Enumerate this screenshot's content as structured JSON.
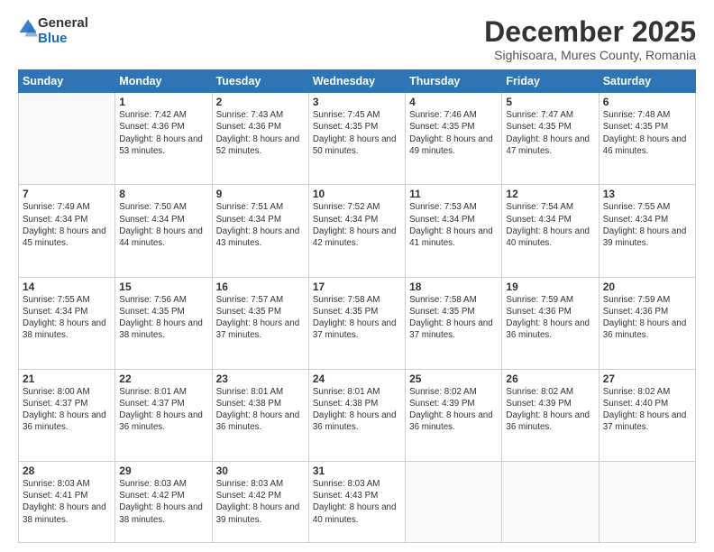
{
  "header": {
    "logo_general": "General",
    "logo_blue": "Blue",
    "month_title": "December 2025",
    "location": "Sighisoara, Mures County, Romania"
  },
  "days_of_week": [
    "Sunday",
    "Monday",
    "Tuesday",
    "Wednesday",
    "Thursday",
    "Friday",
    "Saturday"
  ],
  "weeks": [
    [
      {
        "day": "",
        "sunrise": "",
        "sunset": "",
        "daylight": ""
      },
      {
        "day": "1",
        "sunrise": "Sunrise: 7:42 AM",
        "sunset": "Sunset: 4:36 PM",
        "daylight": "Daylight: 8 hours and 53 minutes."
      },
      {
        "day": "2",
        "sunrise": "Sunrise: 7:43 AM",
        "sunset": "Sunset: 4:36 PM",
        "daylight": "Daylight: 8 hours and 52 minutes."
      },
      {
        "day": "3",
        "sunrise": "Sunrise: 7:45 AM",
        "sunset": "Sunset: 4:35 PM",
        "daylight": "Daylight: 8 hours and 50 minutes."
      },
      {
        "day": "4",
        "sunrise": "Sunrise: 7:46 AM",
        "sunset": "Sunset: 4:35 PM",
        "daylight": "Daylight: 8 hours and 49 minutes."
      },
      {
        "day": "5",
        "sunrise": "Sunrise: 7:47 AM",
        "sunset": "Sunset: 4:35 PM",
        "daylight": "Daylight: 8 hours and 47 minutes."
      },
      {
        "day": "6",
        "sunrise": "Sunrise: 7:48 AM",
        "sunset": "Sunset: 4:35 PM",
        "daylight": "Daylight: 8 hours and 46 minutes."
      }
    ],
    [
      {
        "day": "7",
        "sunrise": "Sunrise: 7:49 AM",
        "sunset": "Sunset: 4:34 PM",
        "daylight": "Daylight: 8 hours and 45 minutes."
      },
      {
        "day": "8",
        "sunrise": "Sunrise: 7:50 AM",
        "sunset": "Sunset: 4:34 PM",
        "daylight": "Daylight: 8 hours and 44 minutes."
      },
      {
        "day": "9",
        "sunrise": "Sunrise: 7:51 AM",
        "sunset": "Sunset: 4:34 PM",
        "daylight": "Daylight: 8 hours and 43 minutes."
      },
      {
        "day": "10",
        "sunrise": "Sunrise: 7:52 AM",
        "sunset": "Sunset: 4:34 PM",
        "daylight": "Daylight: 8 hours and 42 minutes."
      },
      {
        "day": "11",
        "sunrise": "Sunrise: 7:53 AM",
        "sunset": "Sunset: 4:34 PM",
        "daylight": "Daylight: 8 hours and 41 minutes."
      },
      {
        "day": "12",
        "sunrise": "Sunrise: 7:54 AM",
        "sunset": "Sunset: 4:34 PM",
        "daylight": "Daylight: 8 hours and 40 minutes."
      },
      {
        "day": "13",
        "sunrise": "Sunrise: 7:55 AM",
        "sunset": "Sunset: 4:34 PM",
        "daylight": "Daylight: 8 hours and 39 minutes."
      }
    ],
    [
      {
        "day": "14",
        "sunrise": "Sunrise: 7:55 AM",
        "sunset": "Sunset: 4:34 PM",
        "daylight": "Daylight: 8 hours and 38 minutes."
      },
      {
        "day": "15",
        "sunrise": "Sunrise: 7:56 AM",
        "sunset": "Sunset: 4:35 PM",
        "daylight": "Daylight: 8 hours and 38 minutes."
      },
      {
        "day": "16",
        "sunrise": "Sunrise: 7:57 AM",
        "sunset": "Sunset: 4:35 PM",
        "daylight": "Daylight: 8 hours and 37 minutes."
      },
      {
        "day": "17",
        "sunrise": "Sunrise: 7:58 AM",
        "sunset": "Sunset: 4:35 PM",
        "daylight": "Daylight: 8 hours and 37 minutes."
      },
      {
        "day": "18",
        "sunrise": "Sunrise: 7:58 AM",
        "sunset": "Sunset: 4:35 PM",
        "daylight": "Daylight: 8 hours and 37 minutes."
      },
      {
        "day": "19",
        "sunrise": "Sunrise: 7:59 AM",
        "sunset": "Sunset: 4:36 PM",
        "daylight": "Daylight: 8 hours and 36 minutes."
      },
      {
        "day": "20",
        "sunrise": "Sunrise: 7:59 AM",
        "sunset": "Sunset: 4:36 PM",
        "daylight": "Daylight: 8 hours and 36 minutes."
      }
    ],
    [
      {
        "day": "21",
        "sunrise": "Sunrise: 8:00 AM",
        "sunset": "Sunset: 4:37 PM",
        "daylight": "Daylight: 8 hours and 36 minutes."
      },
      {
        "day": "22",
        "sunrise": "Sunrise: 8:01 AM",
        "sunset": "Sunset: 4:37 PM",
        "daylight": "Daylight: 8 hours and 36 minutes."
      },
      {
        "day": "23",
        "sunrise": "Sunrise: 8:01 AM",
        "sunset": "Sunset: 4:38 PM",
        "daylight": "Daylight: 8 hours and 36 minutes."
      },
      {
        "day": "24",
        "sunrise": "Sunrise: 8:01 AM",
        "sunset": "Sunset: 4:38 PM",
        "daylight": "Daylight: 8 hours and 36 minutes."
      },
      {
        "day": "25",
        "sunrise": "Sunrise: 8:02 AM",
        "sunset": "Sunset: 4:39 PM",
        "daylight": "Daylight: 8 hours and 36 minutes."
      },
      {
        "day": "26",
        "sunrise": "Sunrise: 8:02 AM",
        "sunset": "Sunset: 4:39 PM",
        "daylight": "Daylight: 8 hours and 36 minutes."
      },
      {
        "day": "27",
        "sunrise": "Sunrise: 8:02 AM",
        "sunset": "Sunset: 4:40 PM",
        "daylight": "Daylight: 8 hours and 37 minutes."
      }
    ],
    [
      {
        "day": "28",
        "sunrise": "Sunrise: 8:03 AM",
        "sunset": "Sunset: 4:41 PM",
        "daylight": "Daylight: 8 hours and 38 minutes."
      },
      {
        "day": "29",
        "sunrise": "Sunrise: 8:03 AM",
        "sunset": "Sunset: 4:42 PM",
        "daylight": "Daylight: 8 hours and 38 minutes."
      },
      {
        "day": "30",
        "sunrise": "Sunrise: 8:03 AM",
        "sunset": "Sunset: 4:42 PM",
        "daylight": "Daylight: 8 hours and 39 minutes."
      },
      {
        "day": "31",
        "sunrise": "Sunrise: 8:03 AM",
        "sunset": "Sunset: 4:43 PM",
        "daylight": "Daylight: 8 hours and 40 minutes."
      },
      {
        "day": "",
        "sunrise": "",
        "sunset": "",
        "daylight": ""
      },
      {
        "day": "",
        "sunrise": "",
        "sunset": "",
        "daylight": ""
      },
      {
        "day": "",
        "sunrise": "",
        "sunset": "",
        "daylight": ""
      }
    ]
  ]
}
